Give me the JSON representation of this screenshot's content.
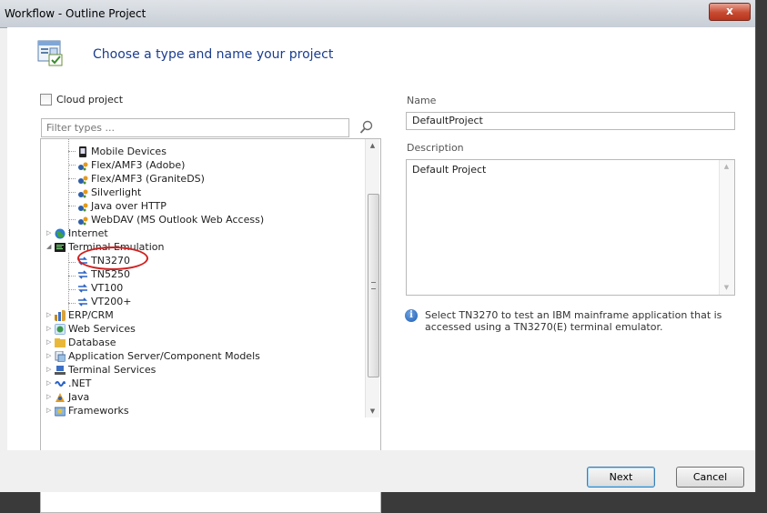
{
  "window": {
    "title": "Workflow - Outline Project",
    "close_glyph": "x"
  },
  "banner": {
    "heading": "Choose a type and name your project",
    "icon": "project-wizard-icon"
  },
  "left": {
    "cloud_label": "Cloud project",
    "cloud_checked": false,
    "filter_placeholder": "Filter types ...",
    "tree": [
      {
        "label": "Mobile Devices",
        "icon": "mobile-device-icon"
      },
      {
        "label": "Flex/AMF3 (Adobe)",
        "icon": "protocol-icon"
      },
      {
        "label": "Flex/AMF3 (GraniteDS)",
        "icon": "protocol-icon"
      },
      {
        "label": "Silverlight",
        "icon": "protocol-icon"
      },
      {
        "label": "Java over HTTP",
        "icon": "protocol-icon"
      },
      {
        "label": "WebDAV (MS Outlook Web Access)",
        "icon": "protocol-icon"
      },
      {
        "label": "Internet",
        "icon": "globe-icon"
      },
      {
        "label": "Terminal Emulation",
        "icon": "terminal-icon"
      },
      {
        "label": "TN3270",
        "icon": "terminal-protocol-icon",
        "selected": true
      },
      {
        "label": "TN5250",
        "icon": "terminal-protocol-icon"
      },
      {
        "label": "VT100",
        "icon": "terminal-protocol-icon"
      },
      {
        "label": "VT200+",
        "icon": "terminal-protocol-icon"
      },
      {
        "label": "ERP/CRM",
        "icon": "erp-icon"
      },
      {
        "label": "Web Services",
        "icon": "web-services-icon"
      },
      {
        "label": "Database",
        "icon": "database-icon"
      },
      {
        "label": "Application Server/Component Models",
        "icon": "app-server-icon"
      },
      {
        "label": "Terminal Services",
        "icon": "terminal-services-icon"
      },
      {
        "label": ".NET",
        "icon": "dotnet-icon"
      },
      {
        "label": "Java",
        "icon": "java-icon"
      },
      {
        "label": "Frameworks",
        "icon": "frameworks-icon"
      }
    ]
  },
  "right": {
    "name_label": "Name",
    "name_value": "DefaultProject",
    "description_label": "Description",
    "description_value": "Default Project",
    "info_text": "Select TN3270 to test an IBM mainframe application that is accessed using a TN3270(E) terminal emulator."
  },
  "footer": {
    "next_label": "Next",
    "cancel_label": "Cancel"
  },
  "colors": {
    "heading": "#1b3d8f",
    "highlight": "#d12020"
  }
}
